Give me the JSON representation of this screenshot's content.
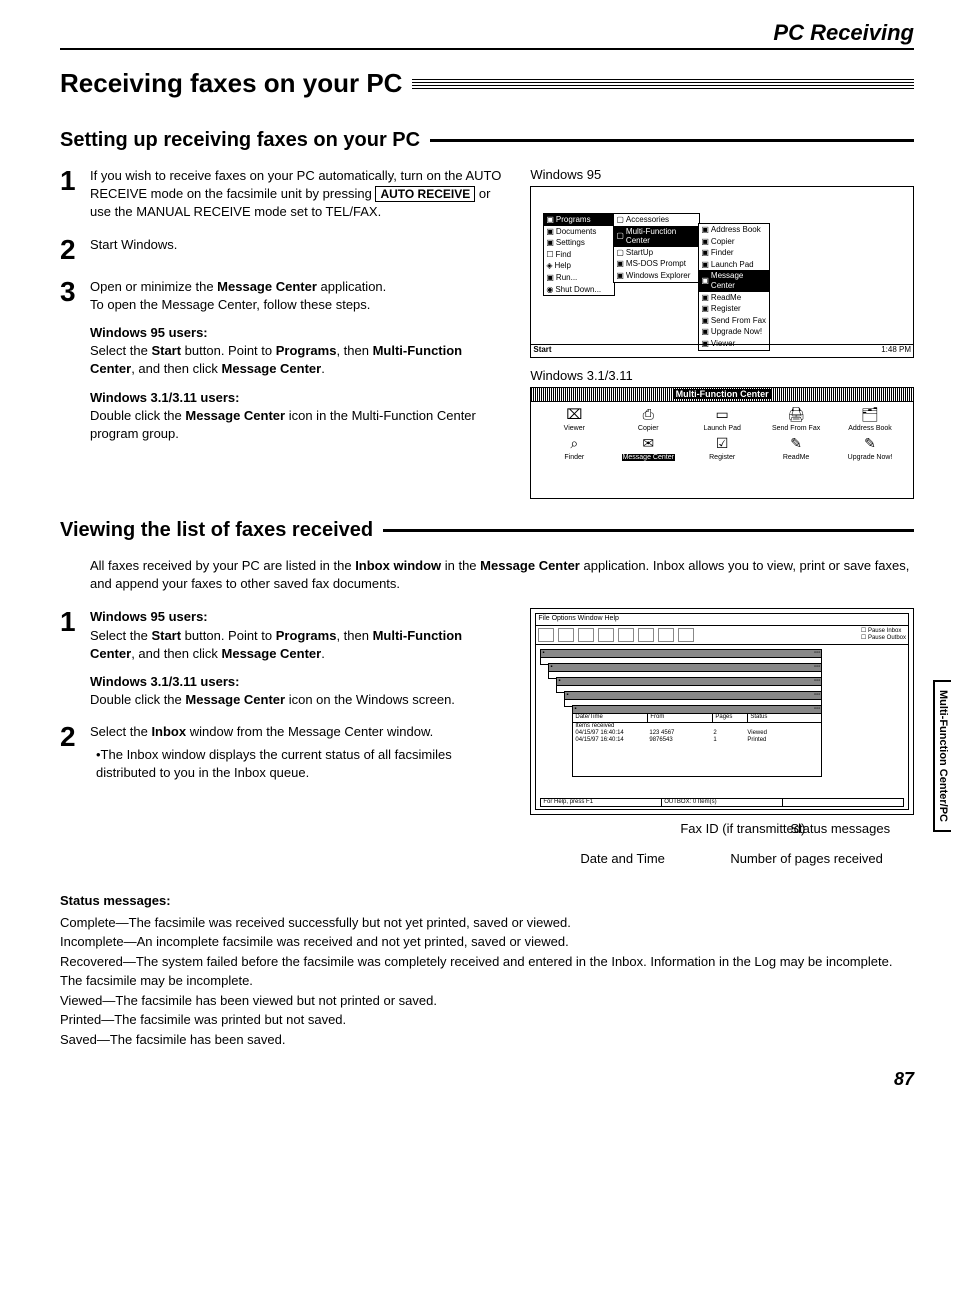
{
  "header": {
    "section": "PC Receiving"
  },
  "page_title": "Receiving faxes on your PC",
  "section1": {
    "title": "Setting up receiving faxes on your PC",
    "step1_a": "If you wish to receive faxes on your PC automatically, turn on the AUTO RECEIVE mode on the facsimile unit by pressing",
    "step1_button": "AUTO RECEIVE",
    "step1_b": " or use the MANUAL RECEIVE mode set to TEL/FAX.",
    "step2": "Start Windows.",
    "step3_a": "Open or minimize the ",
    "step3_bold": "Message Center",
    "step3_b": " application.",
    "step3_c": "To open the Message Center, follow these steps.",
    "w95_label": "Windows 95 users:",
    "w95_text_a": "Select the ",
    "w95_text_b": " button. Point to ",
    "w95_text_c": ", then ",
    "w95_text_d": ", and then click ",
    "w95_text_e": ".",
    "start": "Start",
    "programs": "Programs",
    "mfc": "Multi-Function Center",
    "mc": "Message Center",
    "w31_label": "Windows 3.1/3.11 users:",
    "w31_text_a": "Double click the ",
    "w31_text_b": " icon in the Multi-Function Center program group."
  },
  "figures": {
    "win95_caption": "Windows 95",
    "win31_caption": "Windows 3.1/3.11",
    "startmenu": {
      "items": [
        "Programs",
        "Documents",
        "Settings",
        "Find",
        "Help",
        "Run...",
        "Shut Down..."
      ],
      "sub1": [
        "Accessories",
        "Multi-Function Center",
        "StartUp",
        "MS-DOS Prompt",
        "Windows Explorer"
      ],
      "sub2": [
        "Address Book",
        "Copier",
        "Finder",
        "Launch Pad",
        "Message Center",
        "ReadMe",
        "Register",
        "Send From Fax",
        "Upgrade Now!",
        "Viewer"
      ]
    },
    "taskbar": {
      "start": "Start",
      "time": "1:48 PM"
    },
    "mfc_window": {
      "title": "Multi-Function Center",
      "icons_row1": [
        "Viewer",
        "Copier",
        "Launch Pad",
        "Send From Fax",
        "Address Book"
      ],
      "icons_row2": [
        "Finder",
        "Message Center",
        "Register",
        "ReadMe",
        "Upgrade Now!"
      ]
    }
  },
  "section2": {
    "title": "Viewing the list of faxes received",
    "intro_a": "All faxes received by your PC are listed in the ",
    "intro_bold1": "Inbox window",
    "intro_b": " in the ",
    "intro_bold2": "Message Center",
    "intro_c": " application. Inbox allows you to view, print or save faxes, and append your faxes to other saved fax documents.",
    "step1_w95_label": "Windows 95 users:",
    "step1_w95_a": "Select the ",
    "step1_w95_b": " button. Point to ",
    "step1_w95_c": ", then ",
    "step1_w95_d": ", and then click ",
    "step1_w95_e": ".",
    "step1_w31_label": "Windows 3.1/3.11 users:",
    "step1_w31_a": "Double click the ",
    "step1_w31_b": " icon on the Windows screen.",
    "step2_a": "Select the ",
    "step2_bold": "Inbox",
    "step2_b": " window from the Message Center window.",
    "step2_bullet": "•The Inbox window displays the current status of all facsimiles distributed to you in the Inbox queue."
  },
  "mc_figure": {
    "menubar": "File  Options  Window  Help",
    "pause_inbox": "Pause Inbox",
    "pause_outbox": "Pause Outbox",
    "help_status": "For Help, press F1",
    "outbox_status": "OUTBOX: 0 Item(s)",
    "cols": {
      "dt": "Date/Time",
      "from": "From",
      "pages": "Pages",
      "status": "Status"
    },
    "rows": [
      {
        "label": "Items received",
        "dt": "",
        "from": "",
        "pages": "",
        "status": ""
      },
      {
        "label": "",
        "dt": "04/15/97    16:40:14",
        "from": "123 4567",
        "pages": "2",
        "status": "Viewed"
      },
      {
        "label": "",
        "dt": "04/15/97    16:40:14",
        "from": "9876543",
        "pages": "1",
        "status": "Printed"
      }
    ]
  },
  "callouts": {
    "c1": "Date and Time",
    "c2": "Fax ID (if transmitted)",
    "c3": "Number of pages received",
    "c4": "Status messages"
  },
  "status": {
    "heading": "Status messages:",
    "items": [
      "Complete—The facsimile was received successfully but not yet printed, saved or viewed.",
      "Incomplete—An incomplete facsimile was received and not yet printed, saved or viewed.",
      "Recovered—The system failed before the facsimile was completely received and entered in the Inbox. Information in the Log may be incomplete. The facsimile may be incomplete.",
      "Viewed—The facsimile has been viewed but not printed or saved.",
      "Printed—The facsimile was printed but not saved.",
      "Saved—The facsimile has been saved."
    ]
  },
  "side_tab": "Multi-Function Center/PC",
  "page_number": "87"
}
